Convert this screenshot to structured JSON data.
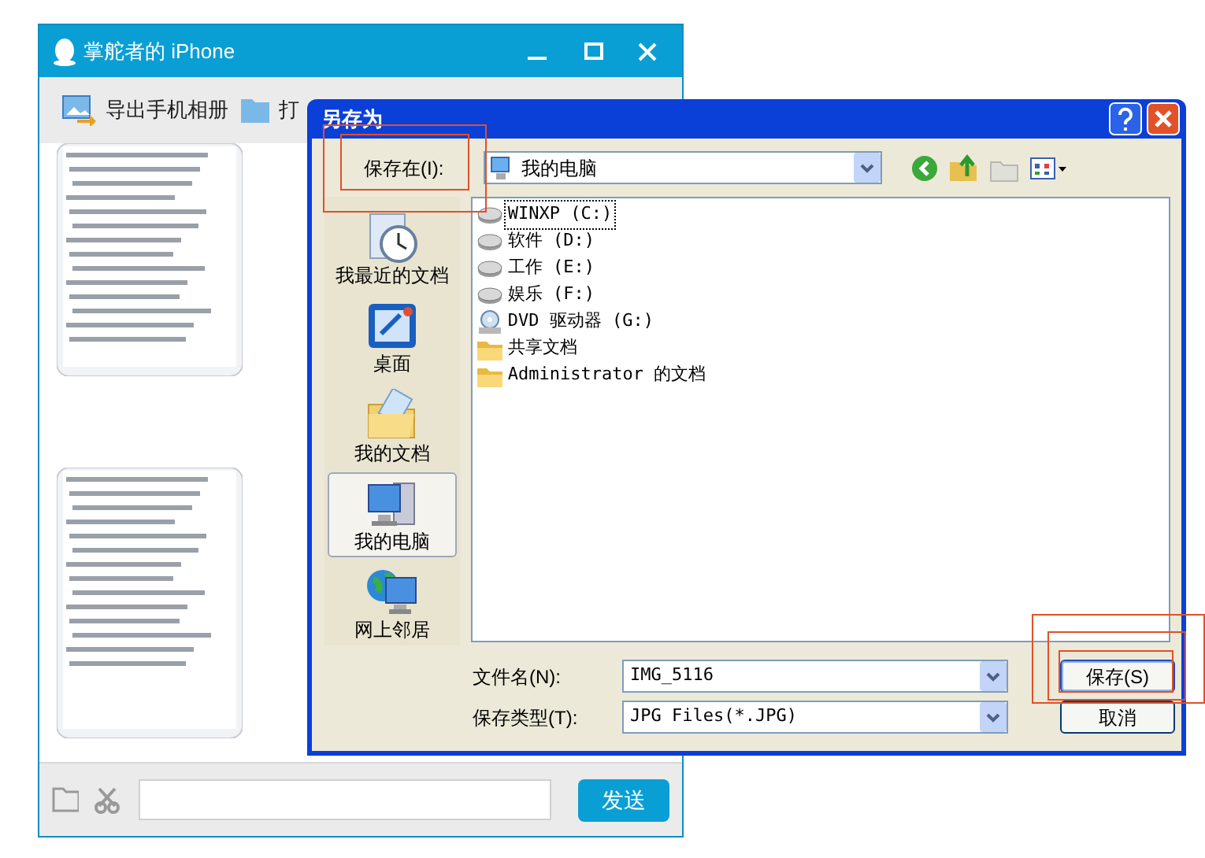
{
  "chat_window": {
    "title": "掌舵者的 iPhone",
    "toolbar": [
      {
        "label": "导出手机相册",
        "kind": "export"
      },
      {
        "label": "打",
        "kind": "folder"
      }
    ],
    "send_button": "发送"
  },
  "save_dialog": {
    "title": "另存为",
    "save_in_label": "保存在(I):",
    "save_in_value": "我的电脑",
    "places": [
      {
        "label": "我最近的文档",
        "kind": "recent",
        "selected": false
      },
      {
        "label": "桌面",
        "kind": "desktop",
        "selected": false
      },
      {
        "label": "我的文档",
        "kind": "documents",
        "selected": false
      },
      {
        "label": "我的电脑",
        "kind": "computer",
        "selected": true
      },
      {
        "label": "网上邻居",
        "kind": "network",
        "selected": false
      }
    ],
    "files": [
      {
        "name": "WINXP (C:)",
        "kind": "drive",
        "focused": true
      },
      {
        "name": "软件 (D:)",
        "kind": "drive",
        "focused": false
      },
      {
        "name": "工作 (E:)",
        "kind": "drive",
        "focused": false
      },
      {
        "name": "娱乐 (F:)",
        "kind": "drive",
        "focused": false
      },
      {
        "name": "DVD 驱动器 (G:)",
        "kind": "dvd",
        "focused": false
      },
      {
        "name": "共享文档",
        "kind": "folder",
        "focused": false
      },
      {
        "name": "Administrator 的文档",
        "kind": "folder",
        "focused": false
      }
    ],
    "file_name_label": "文件名(N):",
    "file_name": "IMG_5116",
    "file_type_label": "保存类型(T):",
    "file_type": "JPG Files(*.JPG)",
    "buttons": [
      "保存(S)",
      "取消"
    ]
  }
}
